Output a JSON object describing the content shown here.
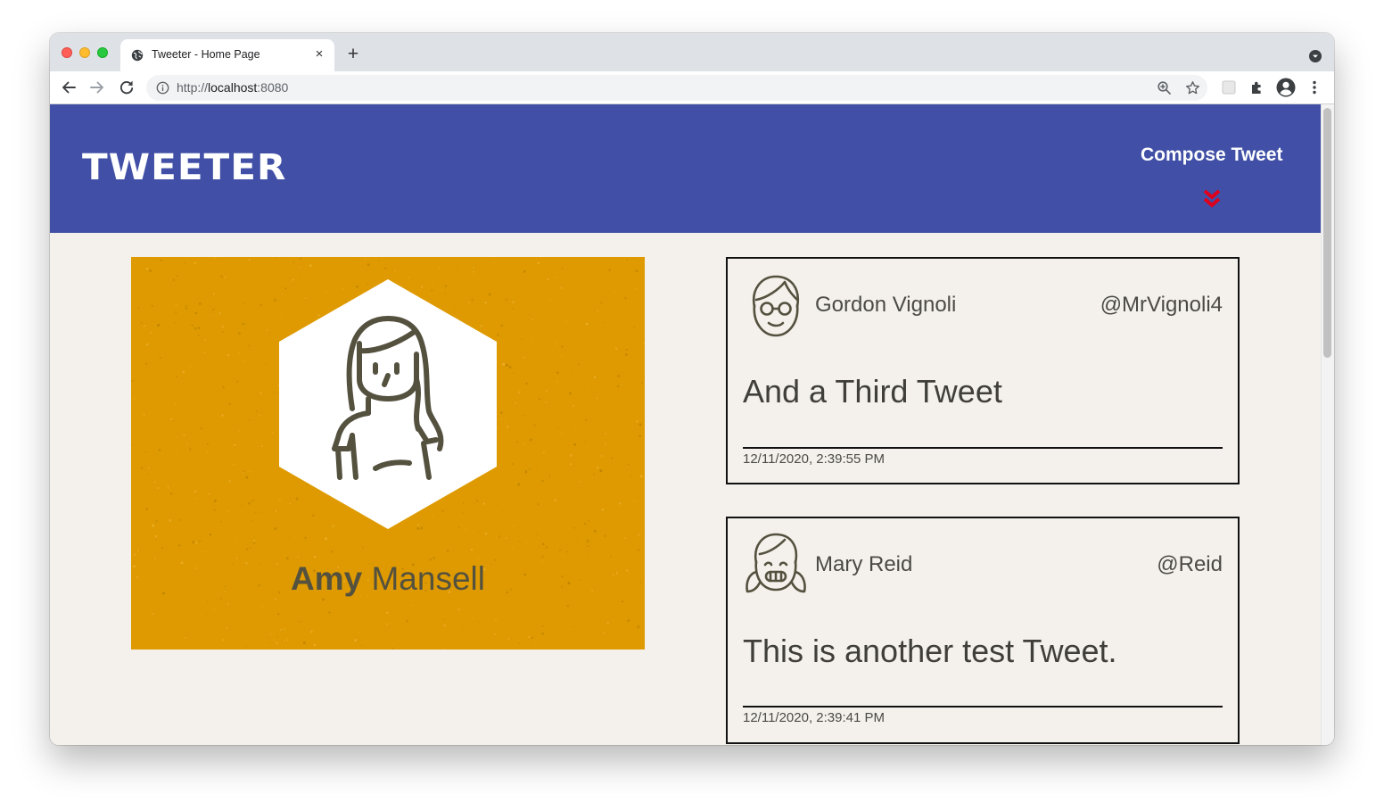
{
  "browser": {
    "tab_title": "Tweeter - Home Page",
    "tab_close_glyph": "×",
    "new_tab_glyph": "+",
    "url_scheme": "http://",
    "url_host": "localhost",
    "url_port": ":8080"
  },
  "header": {
    "logo": "TWEETER",
    "compose_label": "Compose Tweet",
    "background_color": "#4150a6",
    "arrow_color": "#e0001b"
  },
  "profile": {
    "first_name": "Amy",
    "last_name": "Mansell",
    "card_color": "#de9a00"
  },
  "tweets": [
    {
      "author": "Gordon Vignoli",
      "handle": "@MrVignoli4",
      "content": "And a Third Tweet",
      "date": "12/11/2020, 2:39:55 PM",
      "avatar_icon": "boy-glasses-avatar-icon"
    },
    {
      "author": "Mary Reid",
      "handle": "@Reid",
      "content": "This is another test Tweet.",
      "date": "12/11/2020, 2:39:41 PM",
      "avatar_icon": "girl-pigtails-avatar-icon"
    }
  ]
}
